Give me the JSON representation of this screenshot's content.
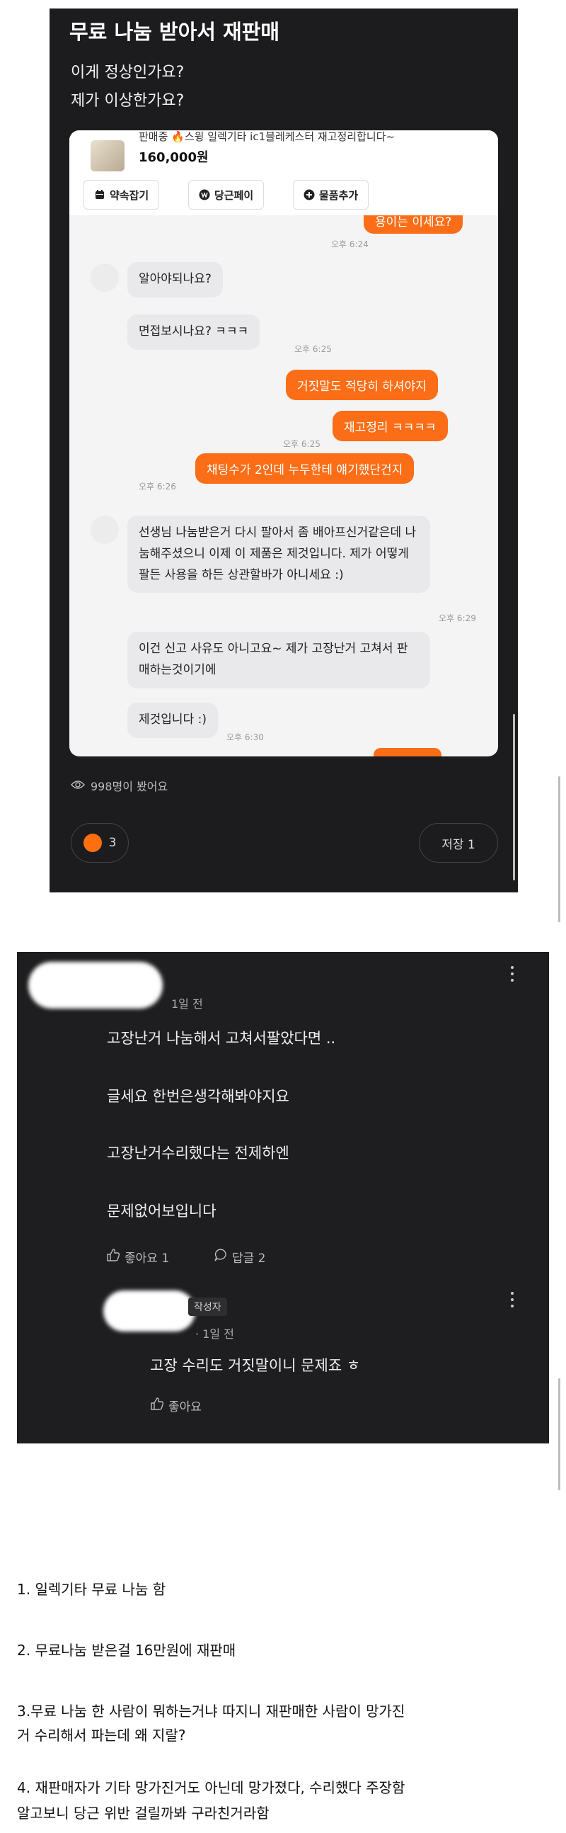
{
  "post": {
    "title": "무료 나눔 받아서 재판매",
    "line1": "이게 정상인가요?",
    "line2": "제가 이상한가요?",
    "chat": {
      "product_name": "판매중 🔥스윙 일렉기타 ic1블레케스터 재고정리합니다~",
      "price": "160,000원",
      "buttons": [
        {
          "label": "약속잡기",
          "icon": "calendar-icon"
        },
        {
          "label": "당근페이",
          "icon": "won-icon"
        },
        {
          "label": "물품추가",
          "icon": "plus-circle-icon"
        }
      ],
      "messages": [
        {
          "side": "right",
          "text": "용이는 이세요?",
          "time": "오후 6:24"
        },
        {
          "side": "left",
          "text": "알아야되나요?",
          "time": ""
        },
        {
          "side": "left",
          "text": "면접보시나요? ㅋㅋㅋ",
          "time": "오후 6:25"
        },
        {
          "side": "right",
          "text": "거짓말도 적당히 하셔야지",
          "time": ""
        },
        {
          "side": "right",
          "text": "재고정리 ㅋㅋㅋㅋ",
          "time": "오후 6:25"
        },
        {
          "side": "right",
          "text": "채팅수가 2인데 누두한테 얘기했단건지",
          "time": "오후 6:26"
        },
        {
          "side": "left",
          "text": "선생님 나눔받은거 다시 팔아서 좀 배아프신거같은데 나눔해주셨으니 이제 이 제품은 제것입니다. 제가 어떻게 팔든 사용을 하든 상관할바가 아니세요 :)",
          "time": "오후 6:29"
        },
        {
          "side": "left",
          "text": "이건 신고 사유도 아니고요~ 제가 고장난거 고쳐서 판매하는것이기에",
          "time": ""
        },
        {
          "side": "left",
          "text": "제것입니다 :)",
          "time": "오후 6:30"
        }
      ]
    },
    "views": "998명이 봤어요",
    "likes": "3",
    "save": "저장 1"
  },
  "comments": {
    "first": {
      "meta": "1일 전",
      "lines": [
        "고장난거 나눔해서 고쳐서팔았다면 ..",
        "글세요 한번은생각해봐야지요",
        "고장난거수리했다는 전제하엔",
        "문제없어보입니다"
      ],
      "like": "좋아요 1",
      "reply": "답글 2"
    },
    "reply": {
      "badge": "작성자",
      "meta": "· 1일 전",
      "text": "고장 수리도 거짓말이니 문제죠 ㅎ",
      "like": "좋아요"
    }
  },
  "notes": [
    "1. 일렉기타 무료 나눔 함",
    "2. 무료나눔 받은걸 16만원에 재판매",
    "3.무료 나눔 한 사람이 뭐하는거냐 따지니 재판매한 사람이 망가진",
    "거 수리해서 파는데 왜 지랄?",
    "4. 재판매자가 기타 망가진거도 아닌데 망가졌다, 수리했다 주장함",
    "알고보니 당근 위반 걸릴까봐 구라친거라함"
  ]
}
